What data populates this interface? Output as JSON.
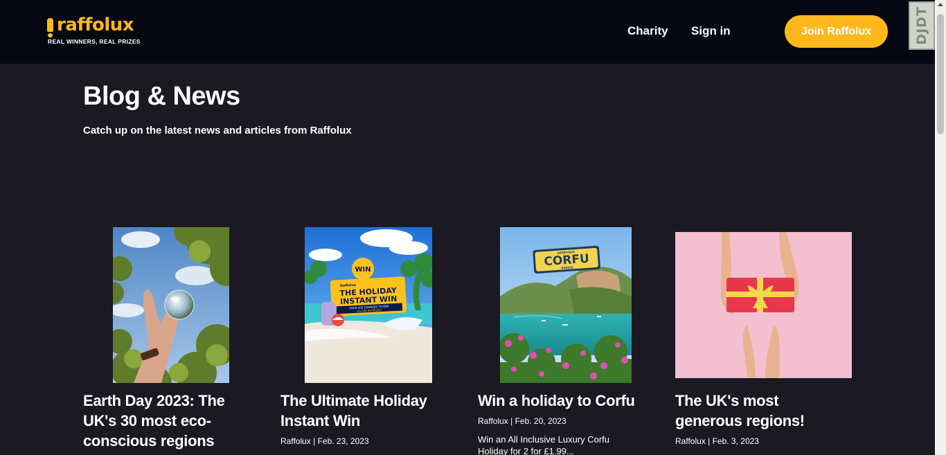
{
  "header": {
    "logo_text": "raffolux",
    "tagline": "REAL WINNERS, REAL PRIZES",
    "nav": {
      "charity": "Charity",
      "sign_in": "Sign in"
    },
    "join_label": "Join Raffolux"
  },
  "devtools": {
    "label": "DJDT"
  },
  "page": {
    "title": "Blog & News",
    "subtitle": "Catch up on the latest news and articles from Raffolux"
  },
  "posts": [
    {
      "title": "Earth Day 2023: The UK's 30 most eco-conscious regions",
      "meta": "",
      "excerpt": "",
      "image": "hand-holding-glass-sphere-trees"
    },
    {
      "title": "The Ultimate Holiday Instant Win",
      "meta": "Raffolux | Feb. 23, 2023",
      "excerpt": "",
      "image": "holiday-instant-win-beach",
      "image_text": {
        "brand": "Raffolux",
        "win": "WIN",
        "headline_1": "THE HOLIDAY",
        "headline_2": "INSTANT WIN",
        "sub": "OVER 200 CHANCES TO WIN",
        "sub2": "£3,000 IN PRIZES"
      }
    },
    {
      "title": "Win a holiday to Corfu",
      "meta": "Raffolux | Feb. 20, 2023",
      "excerpt": "Win an All Inclusive Luxury Corfu Holiday for 2 for £1.99...",
      "image": "corfu-coastline",
      "image_text": {
        "sign": "CORFU",
        "top": "GREETINGS",
        "bottom": "GREECE"
      }
    },
    {
      "title": "The UK's most generous regions!",
      "meta": "Raffolux | Feb. 3, 2023",
      "excerpt": "",
      "image": "hands-giving-gift-box"
    }
  ],
  "colors": {
    "accent": "#ffb81c",
    "header_bg": "#050811",
    "page_bg": "#1b1a23",
    "text": "#ffffff"
  }
}
